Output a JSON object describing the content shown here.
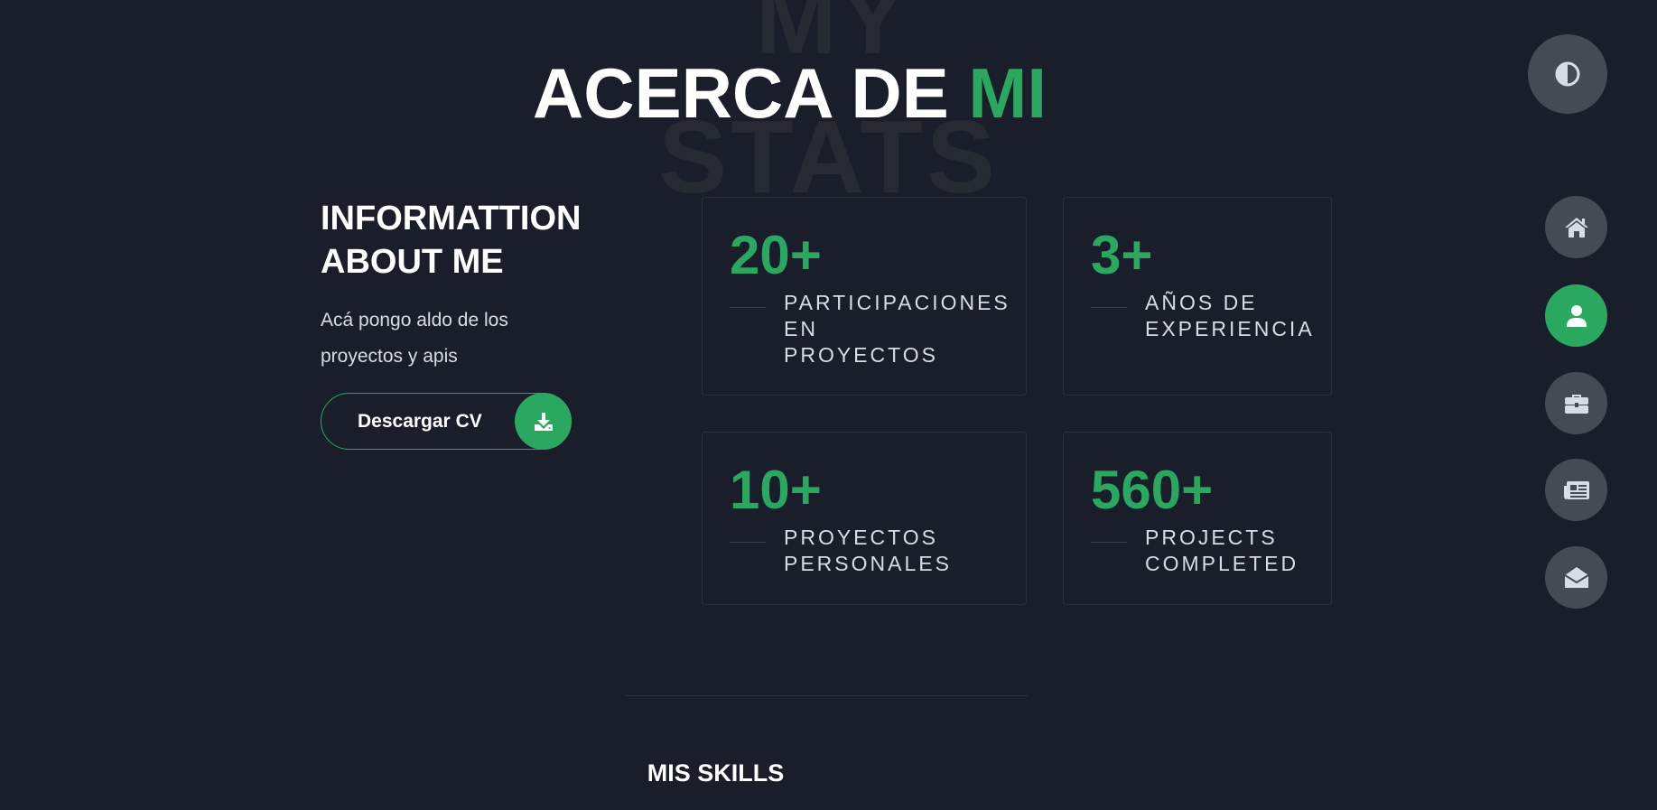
{
  "background": {
    "word1": "MY",
    "word2": "STATS"
  },
  "title": {
    "main": "ACERCA DE ",
    "accent": "MI"
  },
  "info": {
    "heading": "INFORMATTION ABOUT ME",
    "text": "Acá pongo aldo de los proyectos y apis",
    "button_label": "Descargar CV",
    "button_icon": "download-icon"
  },
  "stats": [
    {
      "number": "20+",
      "label": "PARTICIPACIONES\nEN\nPROYECTOS"
    },
    {
      "number": "3+",
      "label": "AÑOS DE\nEXPERIENCIA"
    },
    {
      "number": "10+",
      "label": "PROYECTOS\nPERSONALES"
    },
    {
      "number": "560+",
      "label": "PROJECTS\nCOMPLETED"
    }
  ],
  "skills": {
    "heading": "MIS SKILLS"
  },
  "nav": {
    "theme_icon": "contrast-icon",
    "items": [
      {
        "icon": "home-icon",
        "active": false
      },
      {
        "icon": "user-icon",
        "active": true
      },
      {
        "icon": "briefcase-icon",
        "active": false
      },
      {
        "icon": "newspaper-icon",
        "active": false
      },
      {
        "icon": "envelope-open-icon",
        "active": false
      }
    ]
  },
  "colors": {
    "accent": "#2aa860",
    "background": "#1a1d2a",
    "nav_button": "#454b55",
    "icon": "#d9dce3"
  }
}
